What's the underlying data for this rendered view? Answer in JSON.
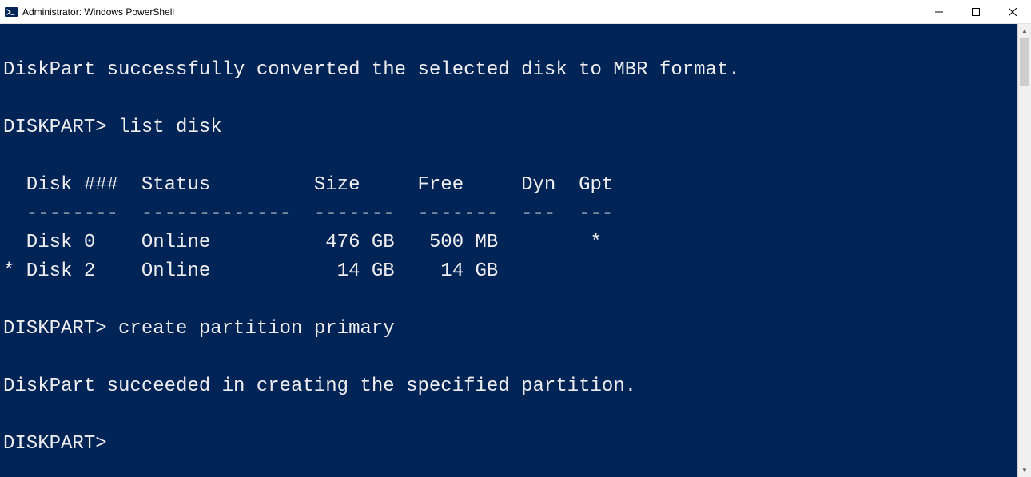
{
  "window": {
    "title": "Administrator: Windows PowerShell"
  },
  "colors": {
    "console_bg": "#012456",
    "console_fg": "#eeeef2"
  },
  "console": {
    "lines": [
      "",
      "DiskPart successfully converted the selected disk to MBR format.",
      "",
      "DISKPART> list disk",
      "",
      "  Disk ###  Status         Size     Free     Dyn  Gpt",
      "  --------  -------------  -------  -------  ---  ---",
      "  Disk 0    Online          476 GB   500 MB        *",
      "* Disk 2    Online           14 GB    14 GB",
      "",
      "DISKPART> create partition primary",
      "",
      "DiskPart succeeded in creating the specified partition.",
      "",
      "DISKPART>"
    ],
    "commands": [
      {
        "prompt": "DISKPART>",
        "command": "list disk"
      },
      {
        "prompt": "DISKPART>",
        "command": "create partition primary"
      },
      {
        "prompt": "DISKPART>",
        "command": ""
      }
    ],
    "disk_table": {
      "headers": [
        "Disk ###",
        "Status",
        "Size",
        "Free",
        "Dyn",
        "Gpt"
      ],
      "rows": [
        {
          "selected": false,
          "disk": "Disk 0",
          "status": "Online",
          "size": "476 GB",
          "free": "500 MB",
          "dyn": "",
          "gpt": "*"
        },
        {
          "selected": true,
          "disk": "Disk 2",
          "status": "Online",
          "size": "14 GB",
          "free": "14 GB",
          "dyn": "",
          "gpt": ""
        }
      ]
    },
    "messages": [
      "DiskPart successfully converted the selected disk to MBR format.",
      "DiskPart succeeded in creating the specified partition."
    ]
  }
}
